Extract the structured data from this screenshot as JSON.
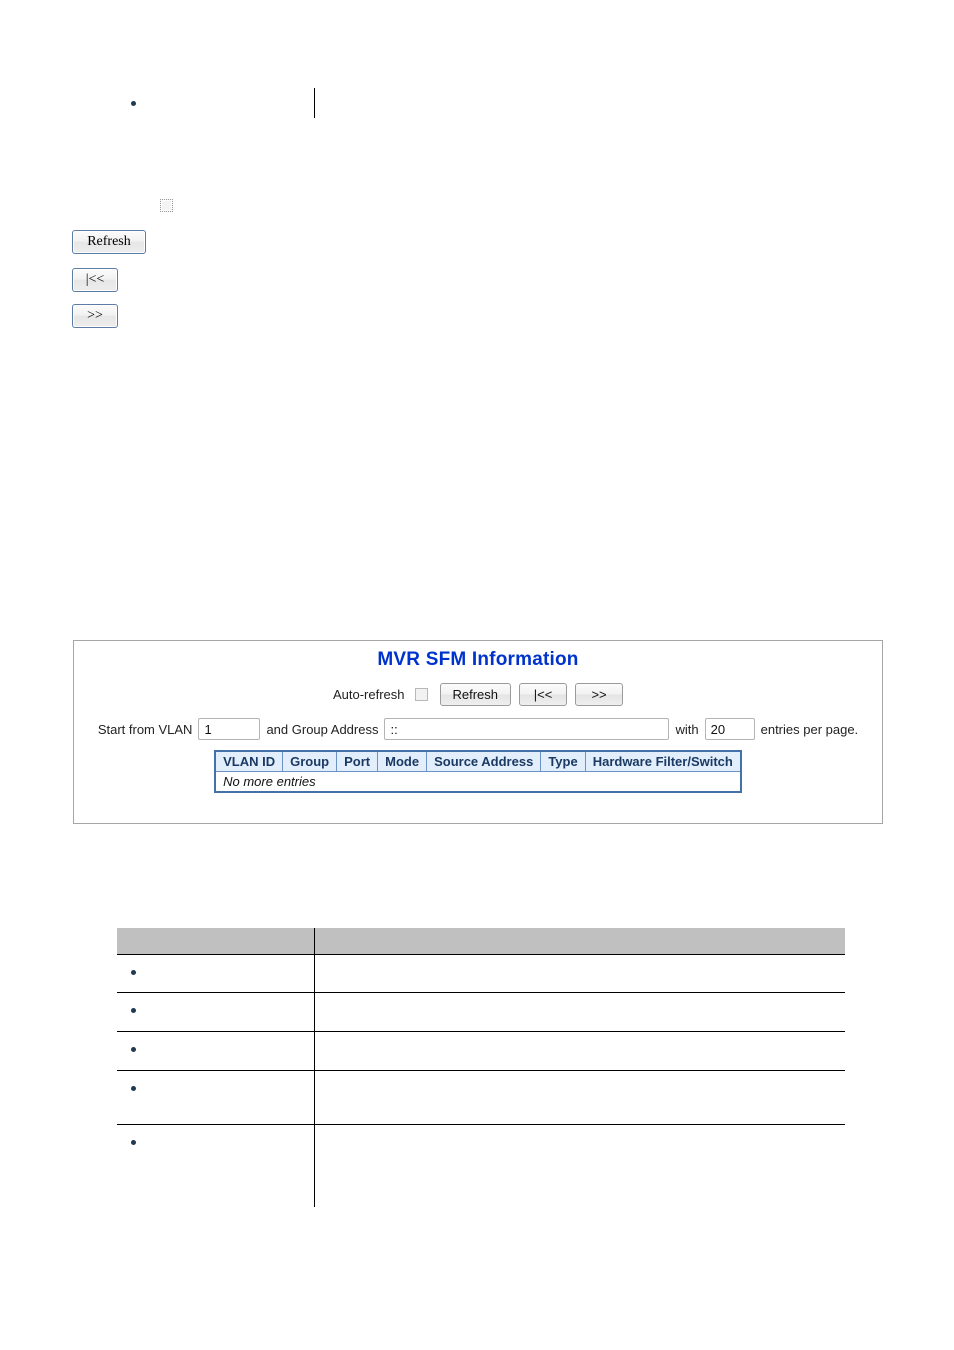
{
  "document": {
    "top_table": {
      "rows": [
        {
          "bullet": "•",
          "term": "",
          "description": ""
        }
      ]
    },
    "stray_controls": {
      "checkbox_name": "auto-refresh-checkbox",
      "checkbox_checked": false,
      "refresh_label": "Refresh",
      "first_page_label": "|<<",
      "next_page_label": ">>"
    },
    "bottom_table": {
      "headers": {
        "object": "",
        "description": ""
      },
      "rows": [
        {
          "bullet": "•",
          "term": "",
          "description": ""
        },
        {
          "bullet": "•",
          "term": "",
          "description": ""
        },
        {
          "bullet": "•",
          "term": "",
          "description": ""
        },
        {
          "bullet": "•",
          "term": "",
          "description": ""
        },
        {
          "bullet": "•",
          "term": "",
          "description": ""
        }
      ]
    }
  },
  "mvr_panel": {
    "title": "MVR SFM Information",
    "title_color": "#0033cc",
    "toolbar": {
      "auto_refresh_label": "Auto-refresh",
      "auto_refresh_checked": false,
      "refresh_label": "Refresh",
      "first_page_label": "|<<",
      "next_page_label": ">>"
    },
    "filter": {
      "start_from_label": "Start from VLAN",
      "vlan_value": "1",
      "and_group_label": "and Group Address",
      "group_value": "::",
      "with_label": "with",
      "entries_value": "20",
      "entries_suffix": "entries per page."
    },
    "table": {
      "columns": [
        "VLAN ID",
        "Group",
        "Port",
        "Mode",
        "Source Address",
        "Type",
        "Hardware Filter/Switch"
      ],
      "empty_message": "No more entries",
      "rows": []
    }
  }
}
